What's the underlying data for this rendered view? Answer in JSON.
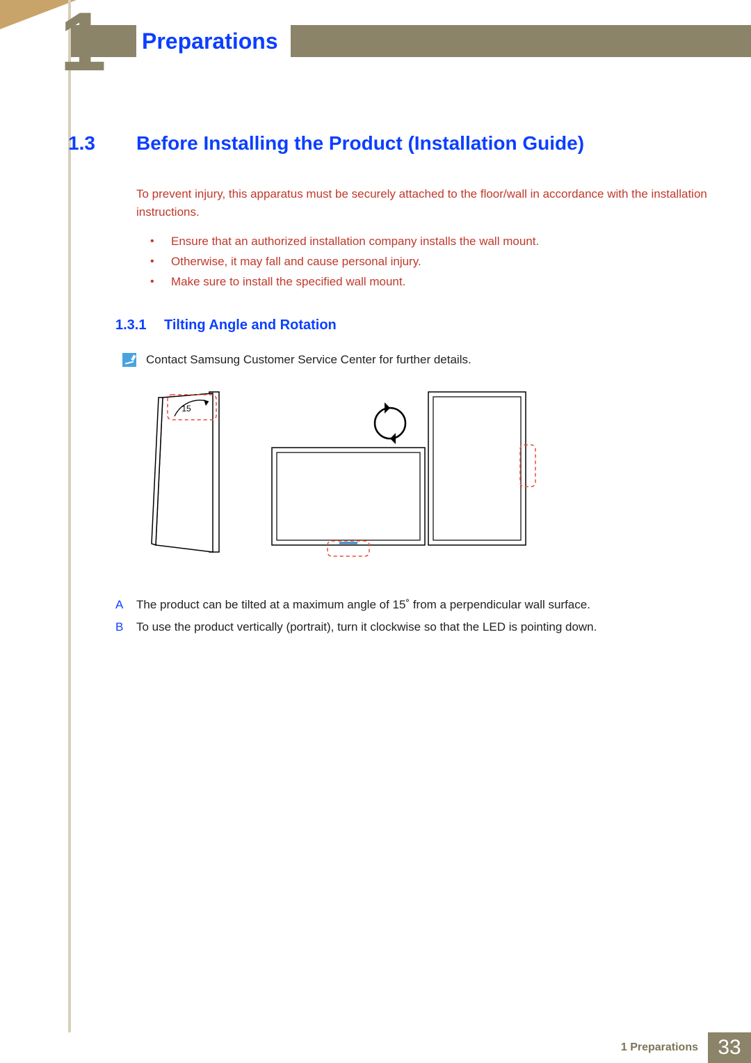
{
  "chapter": {
    "glyph": "1",
    "title": "Preparations"
  },
  "section": {
    "num": "1.3",
    "title": "Before Installing the Product (Installation Guide)"
  },
  "intro": "To prevent injury, this apparatus must be securely attached to the floor/wall in accordance with the installation instructions.",
  "warnings": [
    "Ensure that an authorized installation company installs the wall mount.",
    "Otherwise, it may fall and cause personal injury.",
    "Make sure to install the specified wall mount."
  ],
  "subsection": {
    "num": "1.3.1",
    "title": "Tilting Angle and Rotation"
  },
  "note": "Contact Samsung Customer Service Center for further details.",
  "diagram": {
    "tilt_label": "15"
  },
  "ab": {
    "A": "The product can be tilted at a maximum angle of 15˚ from a perpendicular wall surface.",
    "B": "To use the product vertically (portrait), turn it clockwise so that the LED is pointing down."
  },
  "footer": {
    "section_label": "1 Preparations",
    "page": "33"
  }
}
